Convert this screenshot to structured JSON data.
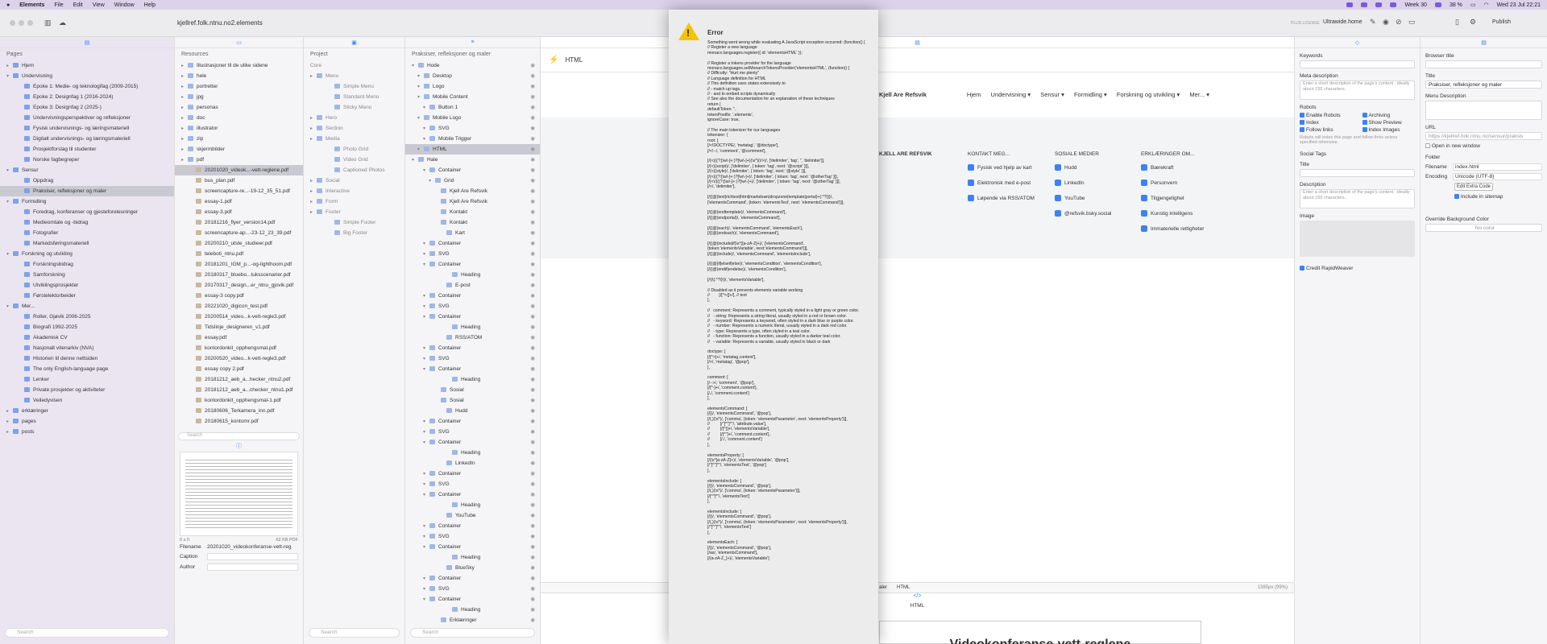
{
  "menubar": {
    "apple": "",
    "items": [
      "Elements",
      "File",
      "Edit",
      "View",
      "Window",
      "Help"
    ],
    "status": [
      "Week 30",
      "38 %",
      "Wed 23 Jul 22:21"
    ]
  },
  "window": {
    "title": "kjellref.folk.ntnu.no2.elements",
    "toolbar": {
      "plus_license": "PLUS LICENSE",
      "site": "Ultrawide.home",
      "publish": "Publish"
    }
  },
  "sidebar": {
    "title": "Pages",
    "items": [
      {
        "label": "Hjem",
        "depth": 0
      },
      {
        "label": "Undervisning",
        "depth": 0,
        "open": true
      },
      {
        "label": "Epoke 1: Medie- og teknologifag (2009-2015)",
        "depth": 1
      },
      {
        "label": "Epoke 2: Designfag 1 (2016-2024)",
        "depth": 1
      },
      {
        "label": "Epoke 3: Designfag 2 (2025-)",
        "depth": 1
      },
      {
        "label": "Undervisningsperspektiver og refleksjoner",
        "depth": 1
      },
      {
        "label": "Fysisk undervisnings- og læringsmateriell",
        "depth": 1
      },
      {
        "label": "Digitalt undervisnings- og læringsmateriell",
        "depth": 1
      },
      {
        "label": "Prosjektforslag til studenter",
        "depth": 1
      },
      {
        "label": "Norske fagbegreper",
        "depth": 1
      },
      {
        "label": "Sensur",
        "depth": 0,
        "open": true
      },
      {
        "label": "Oppdrag",
        "depth": 1
      },
      {
        "label": "Praksiser, refleksjoner og maler",
        "depth": 1,
        "selected": true
      },
      {
        "label": "Formidling",
        "depth": 0,
        "open": true
      },
      {
        "label": "Foredrag, konferanser og gjesteforelesninger",
        "depth": 1
      },
      {
        "label": "Medieomtale og -bidrag",
        "depth": 1
      },
      {
        "label": "Fotografier",
        "depth": 1
      },
      {
        "label": "Markedsføringsmateriell",
        "depth": 1
      },
      {
        "label": "Forskning og utvikling",
        "depth": 0,
        "open": true
      },
      {
        "label": "Forskningsbidrag",
        "depth": 1
      },
      {
        "label": "Samforskning",
        "depth": 1
      },
      {
        "label": "Utviklingsprosjekter",
        "depth": 1
      },
      {
        "label": "Førstelektorbeider",
        "depth": 1
      },
      {
        "label": "Mer...",
        "depth": 0,
        "open": true
      },
      {
        "label": "Roller, Gjøvik 2006-2025",
        "depth": 1
      },
      {
        "label": "Biografi 1992-2025",
        "depth": 1
      },
      {
        "label": "Akademisk CV",
        "depth": 1
      },
      {
        "label": "Nasjonalt vitenarkiv (NVA)",
        "depth": 1
      },
      {
        "label": "Historien til denne nettsiden",
        "depth": 1
      },
      {
        "label": "The only English-language page",
        "depth": 1
      },
      {
        "label": "Lenker",
        "depth": 1
      },
      {
        "label": "Private prosjekter og aktiviteter",
        "depth": 1
      },
      {
        "label": "Veiledyvisen",
        "depth": 1
      },
      {
        "label": "erklæringer",
        "depth": 0
      },
      {
        "label": "pages",
        "depth": 0
      },
      {
        "label": "posts",
        "depth": 0
      }
    ],
    "search": "Search"
  },
  "resources": {
    "title": "Resources",
    "items": [
      "Illustrasjoner til de ulike sidene",
      "hele",
      "portretter",
      "jpg",
      "personas",
      "doc",
      "illustrator",
      "zip",
      "skjermbilder",
      "pdf",
      "20201020_videok...-vett-reglene.pdf",
      "bus_plan.pdf",
      "screencapture-re...-19-12_35_51.pdf",
      "essay-1.pdf",
      "essay-3.pdf",
      "20181216_flyer_version14.pdf",
      "screencapture-ap...-23-12_23_39.pdf",
      "20200210_utste_studieer.pdf",
      "teleboti_ntnu.pdf",
      "20181201_IGM_p...-og-lighthoom.pdf",
      "20180317_bluebo...tuksscenarier.pdf",
      "20170317_design...er_ntnu_gjovik.pdf",
      "essay-3 copy.pdf",
      "20221020_digicon_test.pdf",
      "20200514_video...k-vett-regle3.pdf",
      "Tidslinje_designeren_v1.pdf",
      "essay.pdf",
      "kontordonkit_opphengsmal.pdf",
      "20200520_video...k-vett-regle3.pdf",
      "essay copy 2.pdf",
      "20181212_aeb_a...hecker_ntnu2.pdf",
      "20181212_aeb_a...checker_ntnu1.pdf",
      "kontordonkit_opphengsmal-1.pdf",
      "20180606_Terkamera_inn.pdf",
      "20180615_kontomr.pdf"
    ],
    "search": "Search",
    "meta": {
      "info": "0 x 0",
      "size": "62 KB",
      "type": "PDF"
    },
    "filename_label": "Filename",
    "filename": "20201020_videokonferanse-vett-reg",
    "caption_label": "Caption",
    "author_label": "Author"
  },
  "project": {
    "title": "Project",
    "sections": [
      "Core",
      "Menu",
      "Simple Menu",
      "Standard Menu",
      "Sticky Menu",
      "Hero",
      "Section",
      "Media",
      "Photo Grid",
      "Video Grid",
      "Captioned Photos",
      "Social",
      "Interactive",
      "Form",
      "Footer",
      "Simple Footer",
      "Big Footer"
    ],
    "search": "Search"
  },
  "layers": {
    "title": "Praksiser, refleksjoner og maler",
    "items": [
      "Hode",
      "Desktop",
      "Logo",
      "Mobile Content",
      "Button 1",
      "Mobile Logo",
      "SVG",
      "Mobile Trigger",
      "HTML",
      "Hale",
      "Container",
      "Grid",
      "Kjell Are Refsvik",
      "Kjell Are Refsvik",
      "Kontakt",
      "Kontakt",
      "Kart",
      "Container",
      "SVG",
      "Container",
      "Heading",
      "E-post",
      "Container",
      "SVG",
      "Container",
      "Heading",
      "RSS/ATOM",
      "Container",
      "SVG",
      "Container",
      "Heading",
      "Sosial",
      "Sosial",
      "Hudd",
      "Container",
      "SVG",
      "Container",
      "Heading",
      "LinkedIn",
      "Container",
      "SVG",
      "Container",
      "Heading",
      "YouTube",
      "Container",
      "SVG",
      "Container",
      "Heading",
      "BlueSky",
      "Container",
      "SVG",
      "Container",
      "Heading",
      "Erklæringer"
    ],
    "search": "Search"
  },
  "editor": {
    "tab": "HTML",
    "site_name": "Kjell Are Refsvik",
    "nav": [
      "Hjem",
      "Undervisning ▾",
      "Sensur ▾",
      "Formidling ▾",
      "Forskning og utvikling ▾",
      "Mer... ▾"
    ],
    "footer": {
      "brand": "KJELL ARE REFSVIK",
      "contact_title": "KONTAKT MEG...",
      "contact": [
        "Fysisk ved hjelp av kart",
        "Elektronisk med e-post",
        "Løpende via RSS/ATOM"
      ],
      "social_title": "SOSIALE MEDIER",
      "social": [
        "Hudd",
        "LinkedIn",
        "YouTube",
        "@refsvik.bsky.social"
      ],
      "decl_title": "ERKLÆRINGER OM...",
      "decl": [
        "Bærekraft",
        "Personvern",
        "Tilgjengelighet",
        "Kunstig intelligens",
        "Immaterielle rettigheter"
      ]
    },
    "bottom_tabs": [
      "aler",
      "HTML"
    ],
    "zoom": "1385px (99%)",
    "code_label": "HTML",
    "preview_title": "Videokonferanse-vett-reglene"
  },
  "inspector": {
    "keywords": "Keywords",
    "meta_desc": "Meta description",
    "meta_placeholder": "Enter a short description of the page's content - ideally about 155 characters.",
    "robots": "Robots",
    "robots_opts": [
      "Enable Robots",
      "Archiving",
      "Index",
      "Show Preview",
      "Follow links",
      "Index Images"
    ],
    "robots_note": "Robots will index this page and follow links unless specified otherwise.",
    "social_tags": "Social Tags",
    "title": "Title",
    "description": "Description",
    "desc_placeholder": "Enter a short description of the page's content - ideally about 155 characters.",
    "image": "Image",
    "credit": "Credit RapidWeaver"
  },
  "props": {
    "browser_title": "Browser title",
    "title": "Title",
    "title_value": "Praksiser, refleksjoner og maler",
    "menu_desc": "Menu Description",
    "url": "URL",
    "url_value": "https://kjellref.folk.ntnu.no/sensur/praksis",
    "new_window": "Open in new window",
    "folder": "Folder",
    "filename": "Filename",
    "filename_value": "index.html",
    "encoding": "Encoding",
    "encoding_value": "Unicode (UTF-8)",
    "extra_code": "Edit Extra Code",
    "sitemap": "Include in sitemap",
    "override_bg": "Override Background Color",
    "no_color": "No color"
  },
  "dialog": {
    "title": "Error",
    "text": "Something went wrong while evaluating A JavaScript exception occurred: (function() {\n// Register a new language\nmonaco.languages.register({ id: 'elementsHTML' });\n\n// Register a tokens provider for the language\nmonaco.languages.setMonarchTokensProvider('elementsHTML', (function() {\n// Difficulty: \"Hurt me plenty\"\n// Language definition for HTML\n// This definition uses states extensively to\n// - match up tags.\n// - and to embed scripts dynamically\n// See also the documentation for an explanation of these techniques\nreturn {\ndefaultToken: '',\ntokenPostfix: '.elements',\nignoreCase: true,\n\n// The main tokenizer for our languages\ntokenizer: {\nroot: [\n[/<!DOCTYPE/, 'metatag', '@doctype'],\n[/<!--/, 'comment', '@comment'],\n\n[/(<)((?:[\\w\\-]+:)?[\\w\\-]+)(\\s*)(\\/>)/, ['delimiter', 'tag', '', 'delimiter']],\n[/(<)(script)/, ['delimiter', { token: 'tag', next: '@script' }]],\n[/(<)(style)/, ['delimiter', { token: 'tag', next: '@style' }]],\n[/(<)((?:[\\w\\-]+:)?[\\w\\-]+)/, ['delimiter', { token: 'tag', next: '@otherTag' }]],\n[/(<\\/)((?:[\\w\\-]+:)?[\\w\\-]+)/, ['delimiter', { token: 'tag', next: '@otherTag' }]],\n[/</, 'delimiter'],\n\n[/{{@(text|richtext|html|markdown|dropzone|template|portal)+(.*?)}}/, ['elementsCommand', {token: 'elementsText', next: 'elementsCommand'}]],\n\n[/{{@(endtemplate)/, 'elementsCommand'],\n[/{{@(endportal)/, 'elementsCommand'],\n\n[/{{@(each)/, 'elementsCommand', 'elementsEach'],\n[/{{@(endeach)/, 'elementsCommand'],\n\n[/{{@(include|if)\\s*([a-zA-Z]+)/, ['elementsCommand',\n{token:'elementsVariable', next:'elementsCommand'}]],\n[/{{@(include)/, 'elementsCommand', 'elementsInclude'],\n\n[/{{@(if|elseif|else)/, 'elementsCondition', 'elementsCondition'],\n[/{{@(endif|endelse)/, 'elementsCondition'],\n\n[/\\{\\{.*?\\}\\}/, 'elementsVariable'],\n\n// Disabled as it prevents elements variable working\n//        [/[^<{]+/], // text\n],\n\n//   comment: Represents a comment, typically styled in a light gray or green color.\n//   - string: Represents a string literal, usually styled in a red or brown color.\n//   - keyword: Represents a keyword, often styled in a dark blue or purple color.\n//   - number: Represents a numeric literal, usually styled in a dark red color.\n//   - type: Represents a type, often styled in a teal color.\n//   - function: Represents a function, usually styled in a darker teal color.\n//   - variable: Represents a variable, usually styled in black or dark\n\ndoctype: [\n[/[^>]+/, 'metatag.content'],\n[/>/, 'metatag', '@pop'],\n],\n\ncomment: [\n[/-->/, 'comment', '@pop'],\n[/[^-]+/, 'comment.content'],\n[/./, 'comment.content']\n],\n\nelementsCommand: [\n[/}}/, 'elementsCommand', '@pop'],\n[/(,)(\\s*)/, ['comma', {token: 'elementsParameter', next: 'elementsProperty'}]],\n//         [/\"[^\"]*\"/, 'attribute.value'],\n//         [/[^}]+/, 'elementsVariable'],\n//         [/[^\"]+/, 'comment.content'],\n//         [/./, 'comment.content']\n],\n\nelementsProperty: [\n[/(\\s*[a-zA-Z]+)/, 'elementsVariable', '@pop'],\n[/\"[^\"]*\"/, 'elementsText', '@pop']\n],\n\nelementsInclude: [\n[/}}/, 'elementsCommand', '@pop'],\n[/(,)(\\s*)/, ['comma', {token: 'elementsParameter'}]],\n[/[^\"]*\"/, 'elementsText']\n],\n\nelementsInclude: [\n[/}}/, 'elementsCommand', '@pop'],\n[/(,)(\\s*)/, ['comma', {token: 'elementsParameter', next: 'elementsProperty'}]],\n[/\"[^\"]*\"/, 'elementsText']\n],\n\nelementsEach: [\n[/}}/, 'elementsCommand', '@pop'],\n[/as/, 'elementsCommand'],\n[/(a-zA-Z_]+)/, 'elementsVariable']"
  },
  "colors": {
    "accent": "#3b82f6",
    "selection": "#c9c9d2",
    "warning": "#f5c400"
  }
}
